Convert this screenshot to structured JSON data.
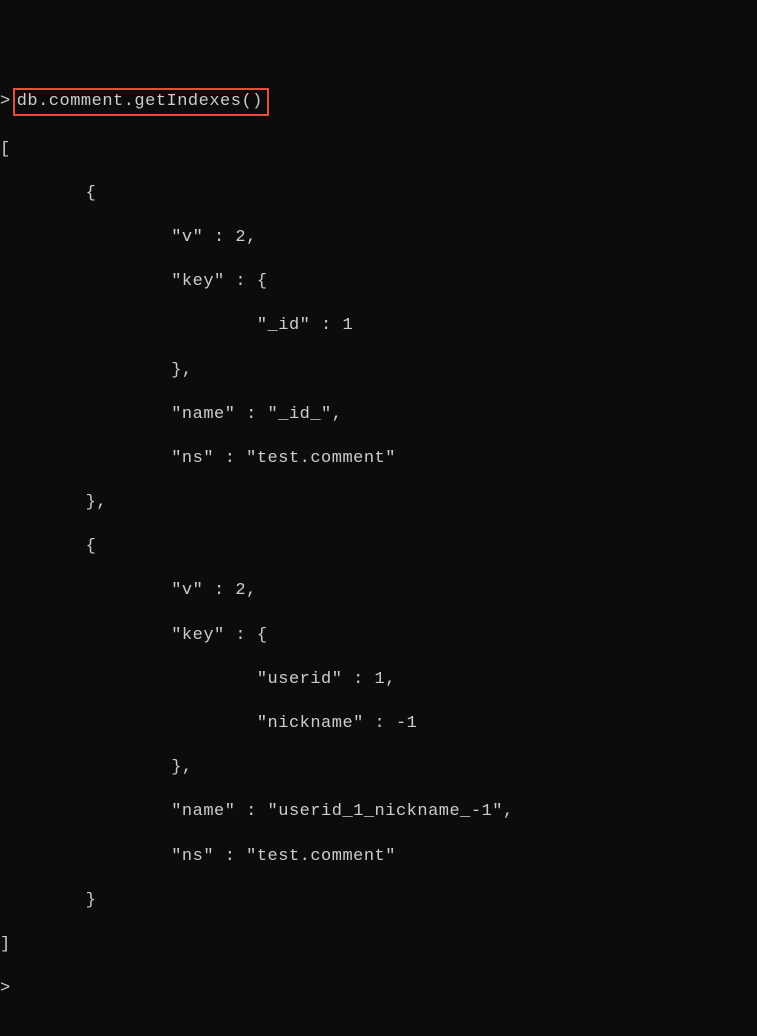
{
  "prompt_symbol": ">",
  "command": "db.comment.getIndexes()",
  "output_open": "[",
  "output_close": "]",
  "bottom_prompt": ">",
  "indexes": [
    {
      "v": 2,
      "key": {
        "_id": 1
      },
      "name": "_id_",
      "ns": "test.comment"
    },
    {
      "v": 2,
      "key": {
        "userid": 1,
        "nickname": -1
      },
      "name": "userid_1_nickname_-1",
      "ns": "test.comment"
    }
  ],
  "lines": {
    "l1": "        {",
    "l2": "                \"v\" : 2,",
    "l3": "                \"key\" : {",
    "l4": "                        \"_id\" : 1",
    "l5": "                },",
    "l6": "                \"name\" : \"_id_\",",
    "l7": "                \"ns\" : \"test.comment\"",
    "l8": "        },",
    "l9": "        {",
    "l10": "                \"v\" : 2,",
    "l11": "                \"key\" : {",
    "l12": "                        \"userid\" : 1,",
    "l13": "                        \"nickname\" : -1",
    "l14": "                },",
    "l15": "                \"name\" : \"userid_1_nickname_-1\",",
    "l16": "                \"ns\" : \"test.comment\"",
    "l17": "        }"
  }
}
